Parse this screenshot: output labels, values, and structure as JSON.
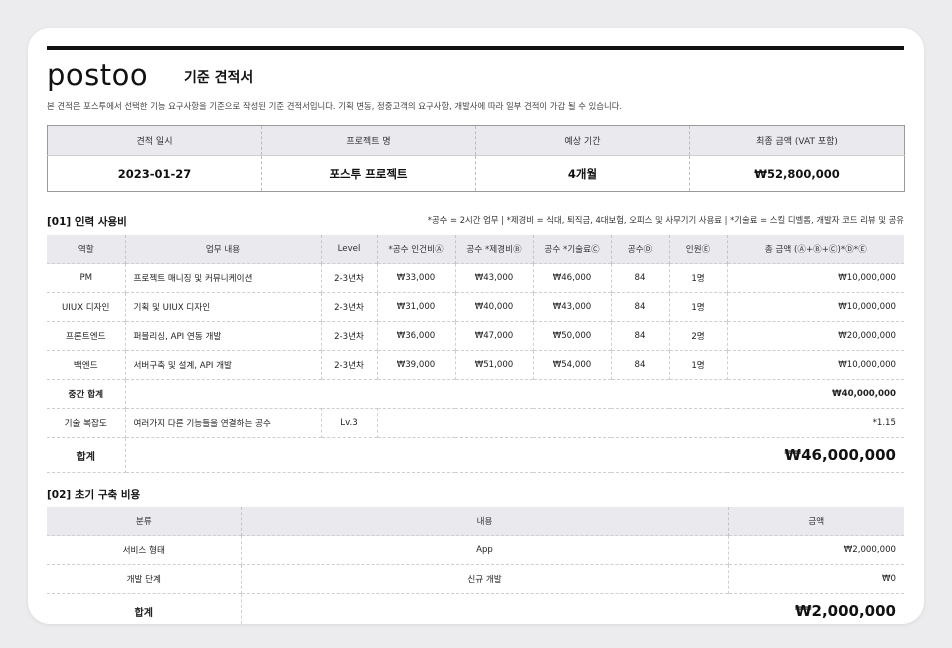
{
  "header": {
    "logo": "postoo",
    "title": "기준 견적서",
    "description": "본 견적은 포스투에서 선택한 기능 요구사항을 기준으로 작성된 기준 견적서입니다. 기획 변동, 정중고객의 요구사항, 개발사에 따라 일부 견적이 가감 될 수 있습니다."
  },
  "summary": {
    "headers": [
      "견적 일시",
      "프로젝트 명",
      "예상 기간",
      "최종 금액 (VAT 포함)"
    ],
    "values": [
      "2023-01-27",
      "포스투 프로젝트",
      "4개월",
      "₩52,800,000"
    ]
  },
  "section1": {
    "title": "[01] 인력 사용비",
    "legend": "*공수 = 2시간 업무 | *제경비 = 식대, 퇴직금, 4대보험, 오피스 및 사무기기 사용료 | *기술료 = 스킬 디벨롭, 개발자 코드 리뷰 및 공유",
    "headers": [
      "역할",
      "업무 내용",
      "Level",
      "*공수 인건비Ⓐ",
      "공수 *제경비Ⓑ",
      "공수 *기술료Ⓒ",
      "공수Ⓓ",
      "인원Ⓔ",
      "총 금액 (Ⓐ+Ⓑ+Ⓒ)*Ⓓ*Ⓔ"
    ],
    "rows": [
      {
        "role": "PM",
        "task": "프로젝트 매니징 및 커뮤니케이션",
        "level": "2-3년차",
        "labor": "₩33,000",
        "expense": "₩43,000",
        "tech": "₩46,000",
        "hours": "84",
        "people": "1명",
        "total": "₩10,000,000"
      },
      {
        "role": "UIUX 디자인",
        "task": "기획 및 UIUX 디자인",
        "level": "2-3년차",
        "labor": "₩31,000",
        "expense": "₩40,000",
        "tech": "₩43,000",
        "hours": "84",
        "people": "1명",
        "total": "₩10,000,000"
      },
      {
        "role": "프론트엔드",
        "task": "퍼블리싱, API 연동 개발",
        "level": "2-3년차",
        "labor": "₩36,000",
        "expense": "₩47,000",
        "tech": "₩50,000",
        "hours": "84",
        "people": "2명",
        "total": "₩20,000,000"
      },
      {
        "role": "백엔드",
        "task": "서버구축 및 설계, API 개발",
        "level": "2-3년차",
        "labor": "₩39,000",
        "expense": "₩51,000",
        "tech": "₩54,000",
        "hours": "84",
        "people": "1명",
        "total": "₩10,000,000"
      }
    ],
    "subtotal_label": "중간 합계",
    "subtotal_value": "₩40,000,000",
    "complexity": {
      "label": "기술 복잡도",
      "task": "여러가지 다른 기능들을 연결하는 공수",
      "level": "Lv.3",
      "value": "*1.15"
    },
    "total_label": "합계",
    "total_value": "₩46,000,000"
  },
  "section2": {
    "title": "[02] 초기 구축 비용",
    "headers": [
      "분류",
      "내용",
      "금액"
    ],
    "rows": [
      {
        "category": "서비스 형태",
        "content": "App",
        "amount": "₩2,000,000"
      },
      {
        "category": "개발 단계",
        "content": "신규 개발",
        "amount": "₩0"
      }
    ],
    "total_label": "합계",
    "total_value": "₩2,000,000"
  }
}
